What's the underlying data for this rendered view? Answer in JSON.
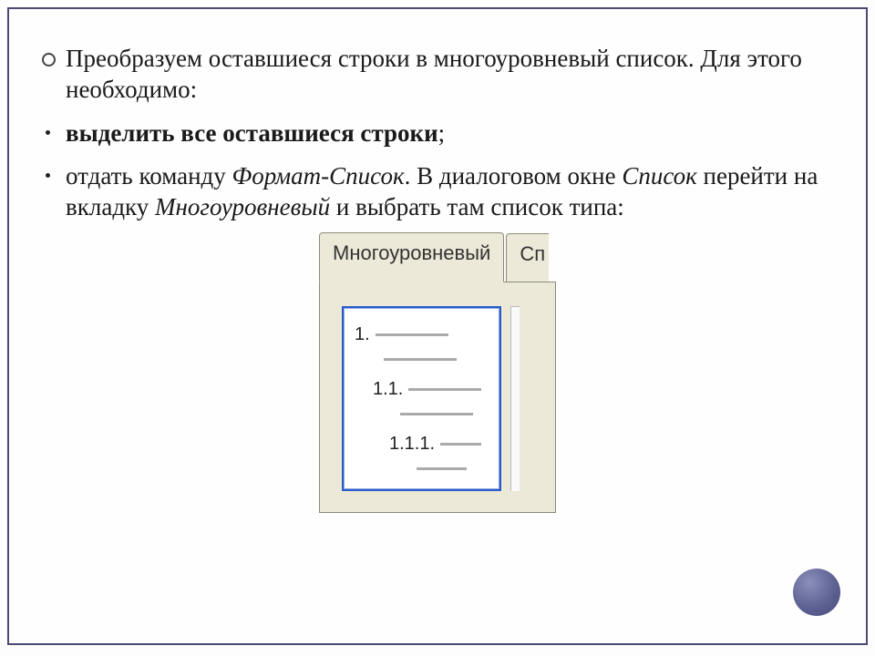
{
  "bullets": {
    "b1": "Преобразуем оставшиеся строки в многоуровневый список. Для этого необходимо:",
    "b2": "выделить все оставшиеся строки",
    "b2_tail": ";",
    "b3_pre": "отдать команду ",
    "b3_cmd": "Формат-Список",
    "b3_mid": ". В диалоговом окне ",
    "b3_dlg": "Список",
    "b3_mid2": " перейти на вкладку ",
    "b3_tab": "Многоуровневый",
    "b3_tail": " и выбрать там список типа:"
  },
  "tabs": {
    "active": "Многоуровневый",
    "partial": "Сп"
  },
  "thumbnail": {
    "level1": "1.",
    "level2": "1.1.",
    "level3": "1.1.1."
  }
}
